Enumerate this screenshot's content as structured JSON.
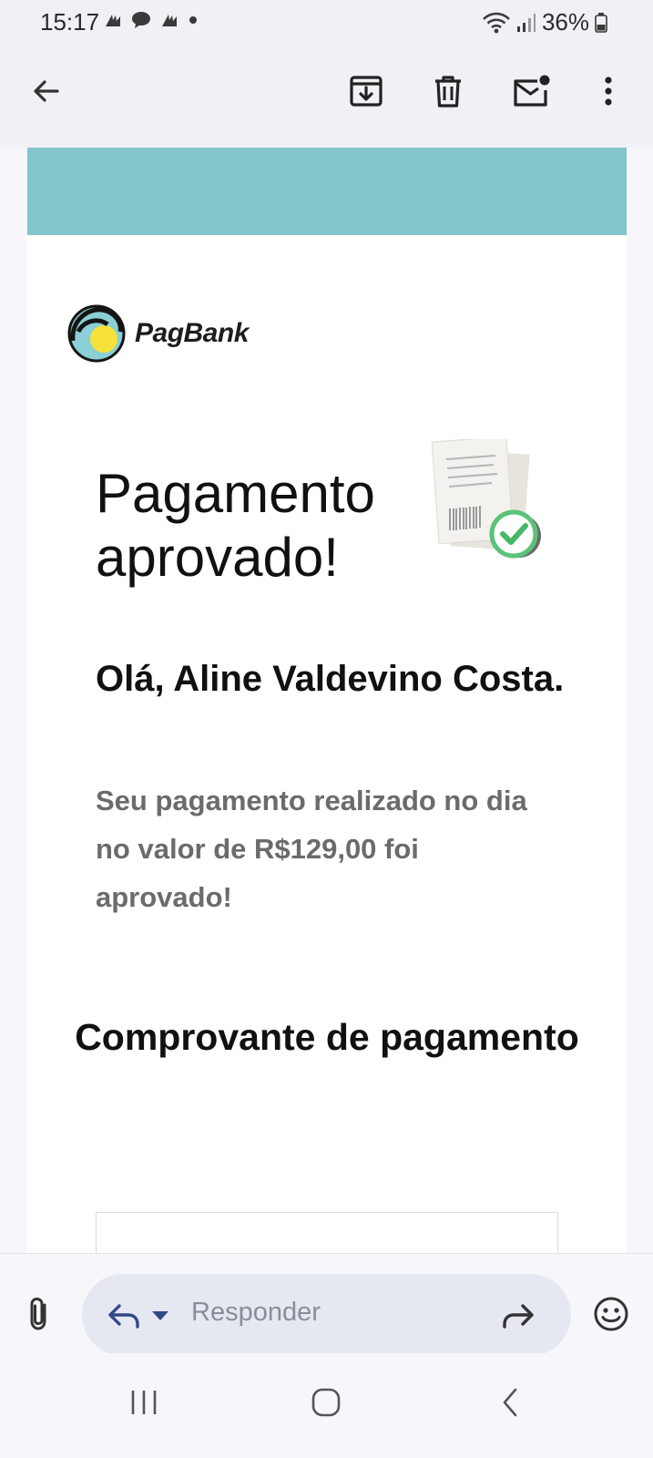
{
  "status_bar": {
    "time": "15:17",
    "battery_percent": "36%",
    "icons": [
      "notification-app-icon",
      "chat-bubble-icon",
      "notification-app-icon",
      "dot-icon",
      "wifi-icon",
      "signal-icon",
      "battery-icon"
    ]
  },
  "toolbar": {
    "icons": [
      "back-arrow-icon",
      "archive-icon",
      "trash-icon",
      "mark-unread-icon",
      "more-vert-icon"
    ]
  },
  "email": {
    "brand_color": "#82c6cc",
    "logo_text": "PagBank",
    "headline": "Pagamento aprovado!",
    "greeting": "Olá, Aline Valdevino Costa.",
    "message": "Seu pagamento realizado no dia no valor de R$129,00 foi aprovado!",
    "receipt_title": "Comprovante de pagamento"
  },
  "reply_bar": {
    "placeholder": "Responder",
    "icons": [
      "attachment-icon",
      "reply-icon",
      "dropdown-arrow-icon",
      "forward-icon",
      "emoji-icon"
    ]
  },
  "nav_bar": {
    "icons": [
      "recent-apps-icon",
      "home-icon",
      "back-nav-icon"
    ]
  }
}
